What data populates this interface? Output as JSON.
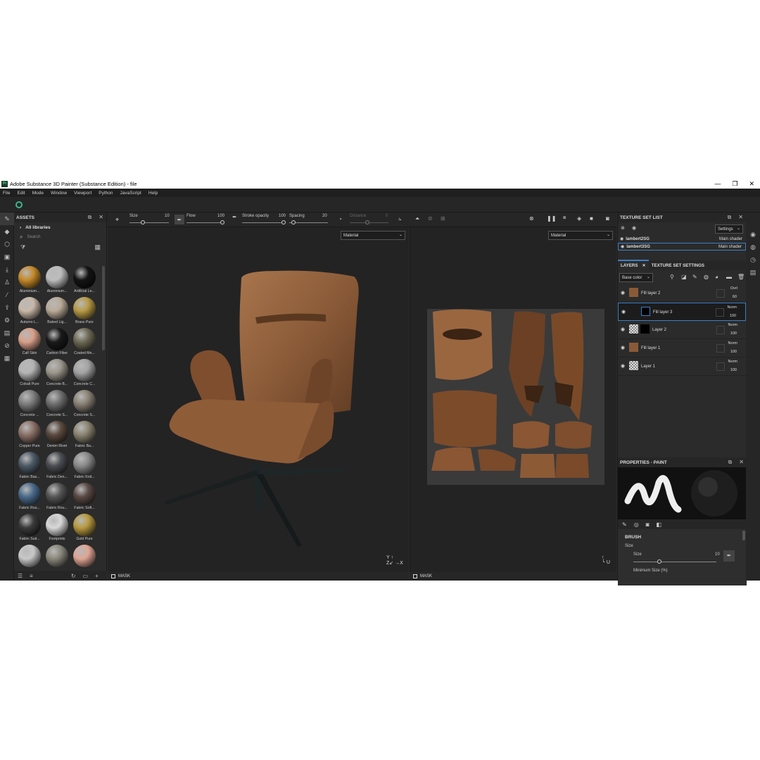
{
  "window": {
    "title": "Adobe Substance 3D Painter (Substance Edition) - file",
    "app_icon": "Pt",
    "controls": [
      "—",
      "❐",
      "✕"
    ]
  },
  "menu": [
    "File",
    "Edit",
    "Mode",
    "Window",
    "Viewport",
    "Python",
    "JavaScript",
    "Help"
  ],
  "assets": {
    "title": "ASSETS",
    "library": "All libraries",
    "search_placeholder": "Search",
    "items": [
      {
        "name": "Aluminium...",
        "color": "#c58a2a"
      },
      {
        "name": "Aluminium...",
        "color": "#bdbdbd"
      },
      {
        "name": "Artificial Le...",
        "color": "#141414"
      },
      {
        "name": "Autumn L...",
        "color": "#c8b8a8"
      },
      {
        "name": "Baked Lig...",
        "color": "#b9aa96"
      },
      {
        "name": "Brass Pure",
        "color": "#b79a45"
      },
      {
        "name": "Calf Skin",
        "color": "#d8a08a"
      },
      {
        "name": "Carbon Fiber",
        "color": "#1a1a1a"
      },
      {
        "name": "Coated Me...",
        "color": "#6e6a55"
      },
      {
        "name": "Cobalt Pure",
        "color": "#b4b4b4"
      },
      {
        "name": "Concrete B...",
        "color": "#9b968b"
      },
      {
        "name": "Concrete C...",
        "color": "#a3a3a3"
      },
      {
        "name": "Concrete ...",
        "color": "#7e7e7e"
      },
      {
        "name": "Concrete S...",
        "color": "#6f6f6f"
      },
      {
        "name": "Concrete S...",
        "color": "#8a8275"
      },
      {
        "name": "Copper Pure",
        "color": "#8c7268"
      },
      {
        "name": "Denim Rivet",
        "color": "#5a4a3e"
      },
      {
        "name": "Fabric Ba...",
        "color": "#8a8470"
      },
      {
        "name": "Fabric Bas...",
        "color": "#4d5a66"
      },
      {
        "name": "Fabric Den...",
        "color": "#4a4d52"
      },
      {
        "name": "Fabric Knit...",
        "color": "#8a8a8a"
      },
      {
        "name": "Fabric Rou...",
        "color": "#4a6a8a"
      },
      {
        "name": "Fabric Rou...",
        "color": "#555555"
      },
      {
        "name": "Fabric Soft...",
        "color": "#5a4a45"
      },
      {
        "name": "Fabric Suit...",
        "color": "#3a3a3a"
      },
      {
        "name": "Footprints",
        "color": "#d8d8d8"
      },
      {
        "name": "Gold Pure",
        "color": "#b89a40"
      },
      {
        "name": "",
        "color": "#c8c8c8"
      },
      {
        "name": "",
        "color": "#8a887c"
      },
      {
        "name": "",
        "color": "#e0a594"
      }
    ]
  },
  "toolbar": {
    "size_label": "Size",
    "size_value": "10",
    "flow_label": "Flow",
    "flow_value": "100",
    "stroke_label": "Stroke opacity",
    "stroke_value": "100",
    "spacing_label": "Spacing",
    "spacing_value": "20",
    "distance_label": "Distance",
    "distance_value": "0"
  },
  "viewports": {
    "left_material": "Material",
    "right_material": "Material",
    "mask_label": "MASK"
  },
  "texture_set_list": {
    "title": "TEXTURE SET LIST",
    "settings": "Settings",
    "sets": [
      {
        "name": "lambert2SG",
        "shader": "Main shader"
      },
      {
        "name": "lambert3SG",
        "shader": "Main shader"
      }
    ]
  },
  "layers_panel": {
    "tab_layers": "LAYERS",
    "tab_settings": "TEXTURE SET SETTINGS",
    "channel": "Base color",
    "layers": [
      {
        "name": "Fill layer 2",
        "blend": "Ovrl",
        "opacity": "60"
      },
      {
        "name": "Fill layer 3",
        "blend": "Norm",
        "opacity": "100"
      },
      {
        "name": "Layer 2",
        "blend": "Norm",
        "opacity": "100"
      },
      {
        "name": "Fill layer 1",
        "blend": "Norm",
        "opacity": "100"
      },
      {
        "name": "Layer 1",
        "blend": "Norm",
        "opacity": "100"
      }
    ]
  },
  "properties": {
    "title": "PROPERTIES - PAINT",
    "section": "BRUSH",
    "size_group": "Size",
    "size_label": "Size",
    "size_value": "10",
    "min_size_label": "Minimum Size (%)"
  },
  "colors": {
    "accent": "#3d7fc4",
    "leather": "#8a5a3a",
    "bg": "#2b2b2b"
  }
}
